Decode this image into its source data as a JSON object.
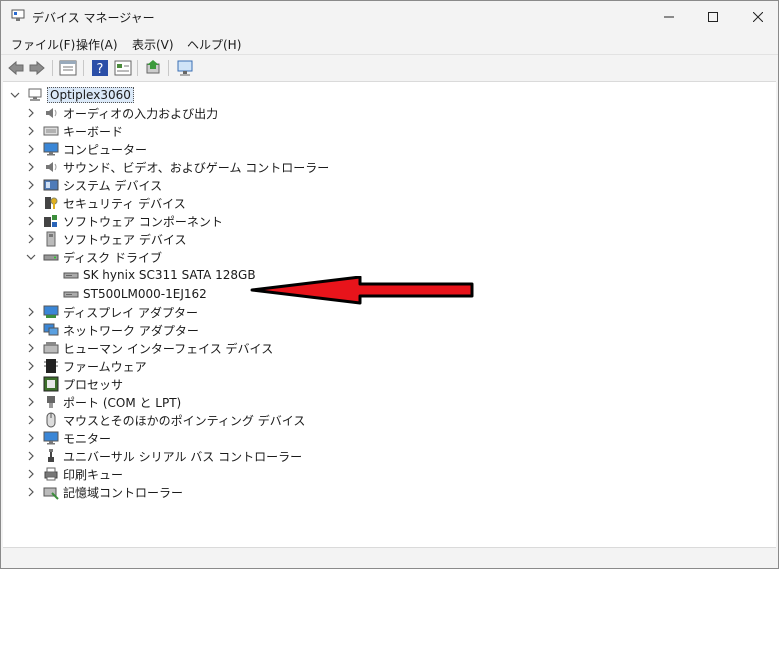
{
  "window": {
    "title": "デバイス マネージャー"
  },
  "menu": [
    {
      "label": "ファイル(F)"
    },
    {
      "label": "操作(A)"
    },
    {
      "label": "表示(V)"
    },
    {
      "label": "ヘルプ(H)"
    }
  ],
  "tree": {
    "root": "Optiplex3060",
    "categories": [
      {
        "label": "オーディオの入力および出力",
        "icon": "speaker-icon"
      },
      {
        "label": "キーボード",
        "icon": "keyboard-icon"
      },
      {
        "label": "コンピューター",
        "icon": "monitor-icon"
      },
      {
        "label": "サウンド、ビデオ、およびゲーム コントローラー",
        "icon": "speaker-icon"
      },
      {
        "label": "システム デバイス",
        "icon": "system-device-icon"
      },
      {
        "label": "セキュリティ デバイス",
        "icon": "security-key-icon"
      },
      {
        "label": "ソフトウェア コンポーネント",
        "icon": "software-component-icon"
      },
      {
        "label": "ソフトウェア デバイス",
        "icon": "software-device-icon"
      },
      {
        "label": "ディスク ドライブ",
        "icon": "disk-drive-icon",
        "expanded": true,
        "children": [
          "SK hynix SC311 SATA 128GB",
          "ST500LM000-1EJ162"
        ]
      },
      {
        "label": "ディスプレイ アダプター",
        "icon": "display-adapter-icon"
      },
      {
        "label": "ネットワーク アダプター",
        "icon": "network-icon"
      },
      {
        "label": "ヒューマン インターフェイス デバイス",
        "icon": "hid-icon"
      },
      {
        "label": "ファームウェア",
        "icon": "firmware-icon"
      },
      {
        "label": "プロセッサ",
        "icon": "processor-icon"
      },
      {
        "label": "ポート (COM と LPT)",
        "icon": "port-icon"
      },
      {
        "label": "マウスとそのほかのポインティング デバイス",
        "icon": "mouse-icon"
      },
      {
        "label": "モニター",
        "icon": "monitor-icon"
      },
      {
        "label": "ユニバーサル シリアル バス コントローラー",
        "icon": "usb-icon"
      },
      {
        "label": "印刷キュー",
        "icon": "printer-icon"
      },
      {
        "label": "記憶域コントローラー",
        "icon": "storage-controller-icon"
      }
    ]
  },
  "colors": {
    "arrow": "#e8141b",
    "selection": "#dbe9f8"
  }
}
